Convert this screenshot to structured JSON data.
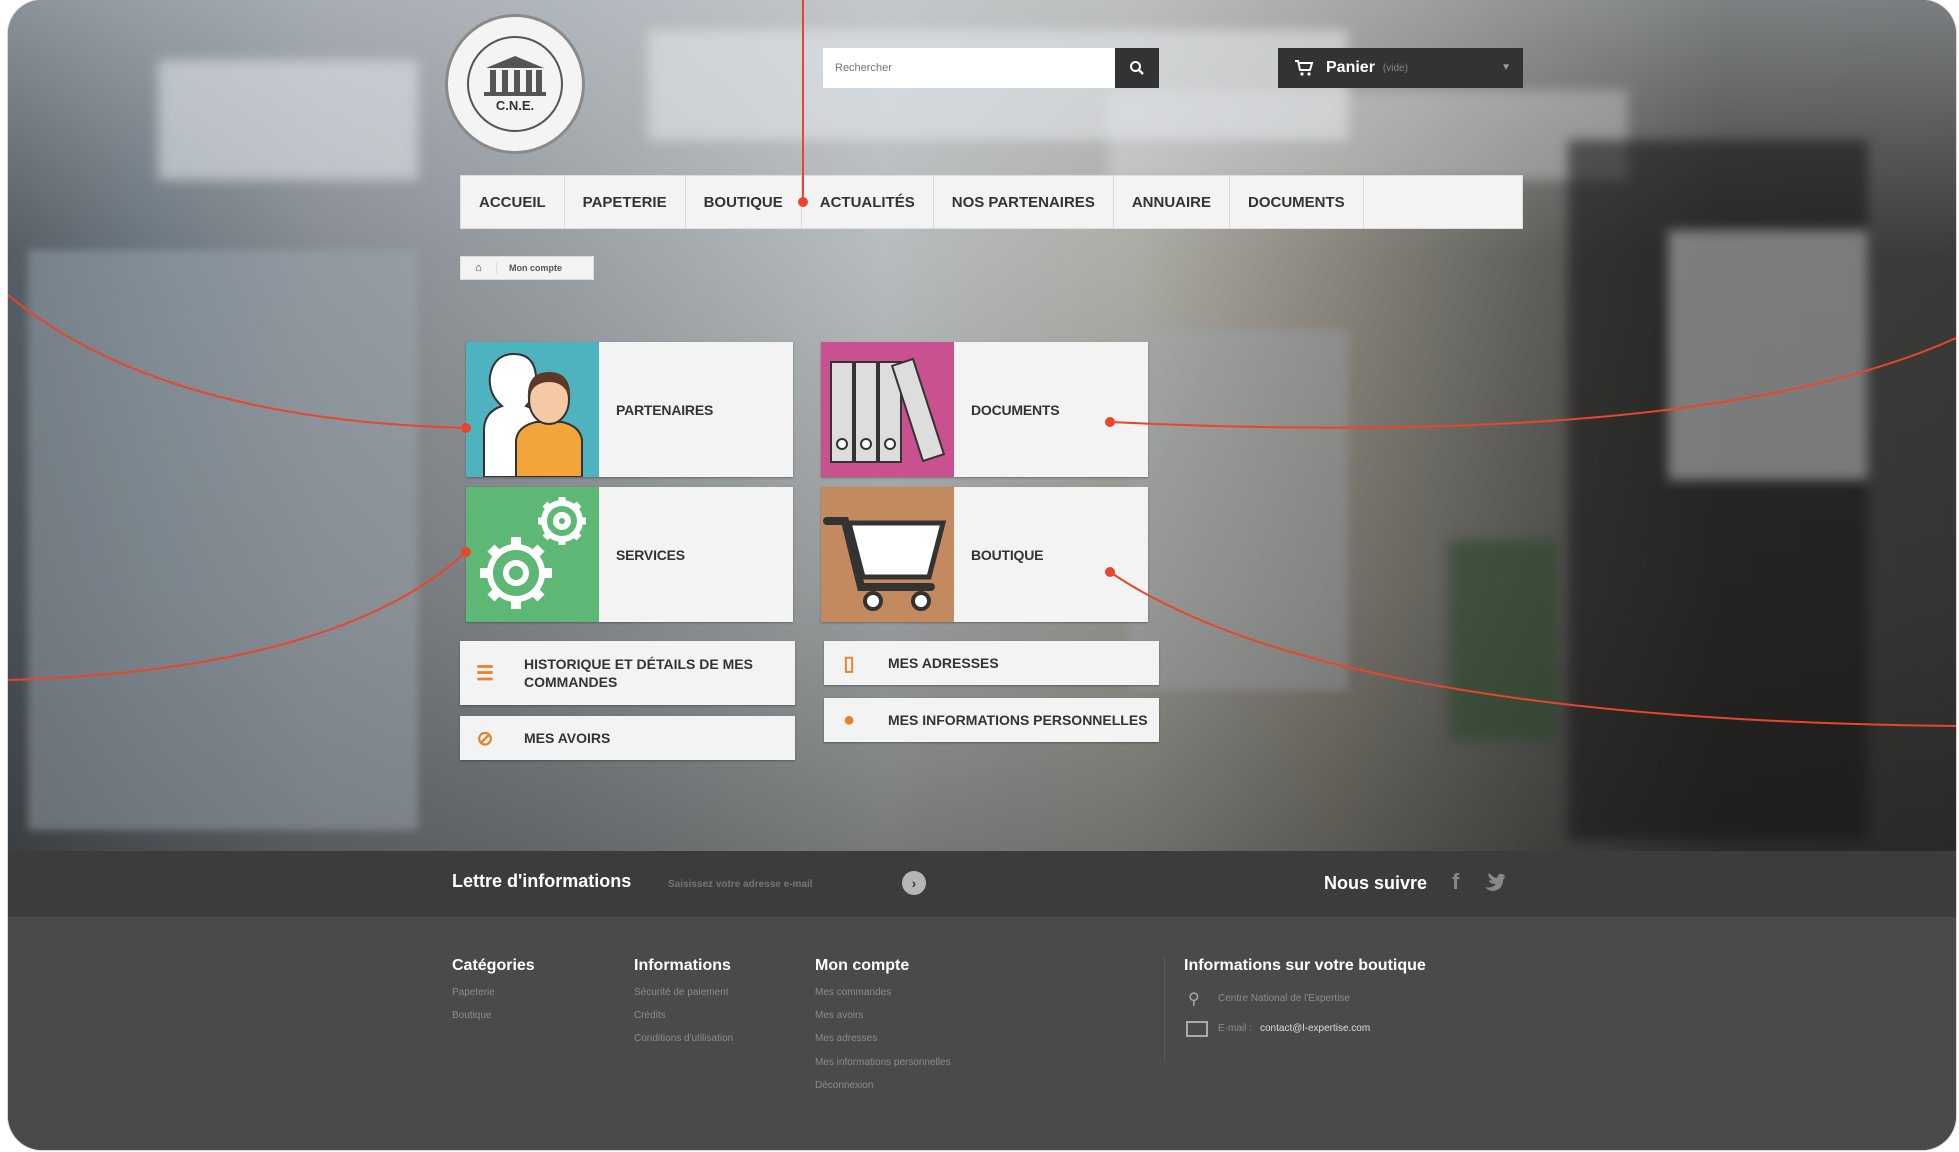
{
  "header": {
    "logo_text": "C.N.E.",
    "search_placeholder": "Rechercher",
    "cart_label": "Panier",
    "cart_status": "(vide)"
  },
  "nav": {
    "items": [
      "ACCUEIL",
      "PAPETERIE",
      "BOUTIQUE",
      "ACTUALITÉS",
      "NOS PARTENAIRES",
      "ANNUAIRE",
      "DOCUMENTS"
    ]
  },
  "breadcrumb": {
    "current": "Mon compte"
  },
  "tiles": {
    "partenaires": "PARTENAIRES",
    "documents": "DOCUMENTS",
    "services": "SERVICES",
    "boutique": "BOUTIQUE"
  },
  "account": {
    "orders": "HISTORIQUE ET DÉTAILS DE MES COMMANDES",
    "addresses": "MES ADRESSES",
    "credits": "MES AVOIRS",
    "personal": "MES INFORMATIONS PERSONNELLES"
  },
  "newsletter": {
    "title": "Lettre d'informations",
    "placeholder": "Saisissez votre adresse e-mail",
    "follow": "Nous suivre"
  },
  "footer": {
    "categories": {
      "title": "Catégories",
      "links": [
        "Papeterie",
        "Boutique"
      ]
    },
    "informations": {
      "title": "Informations",
      "links": [
        "Sécurité de paiement",
        "Crédits",
        "Conditions d'utilisation"
      ]
    },
    "account": {
      "title": "Mon compte",
      "links": [
        "Mes commandes",
        "Mes avoirs",
        "Mes adresses",
        "Mes informations personnelles",
        "Déconnexion"
      ]
    },
    "shop": {
      "title": "Informations sur votre boutique",
      "name": "Centre National de l'Expertise",
      "email_label": "E-mail :",
      "email": "contact@l-expertise.com"
    }
  },
  "colors": {
    "teal": "#4fb3bf",
    "pink": "#c9518f",
    "green": "#5cb874",
    "brown": "#c48a5f",
    "accent": "#e8812a",
    "callout": "#e8452c"
  }
}
